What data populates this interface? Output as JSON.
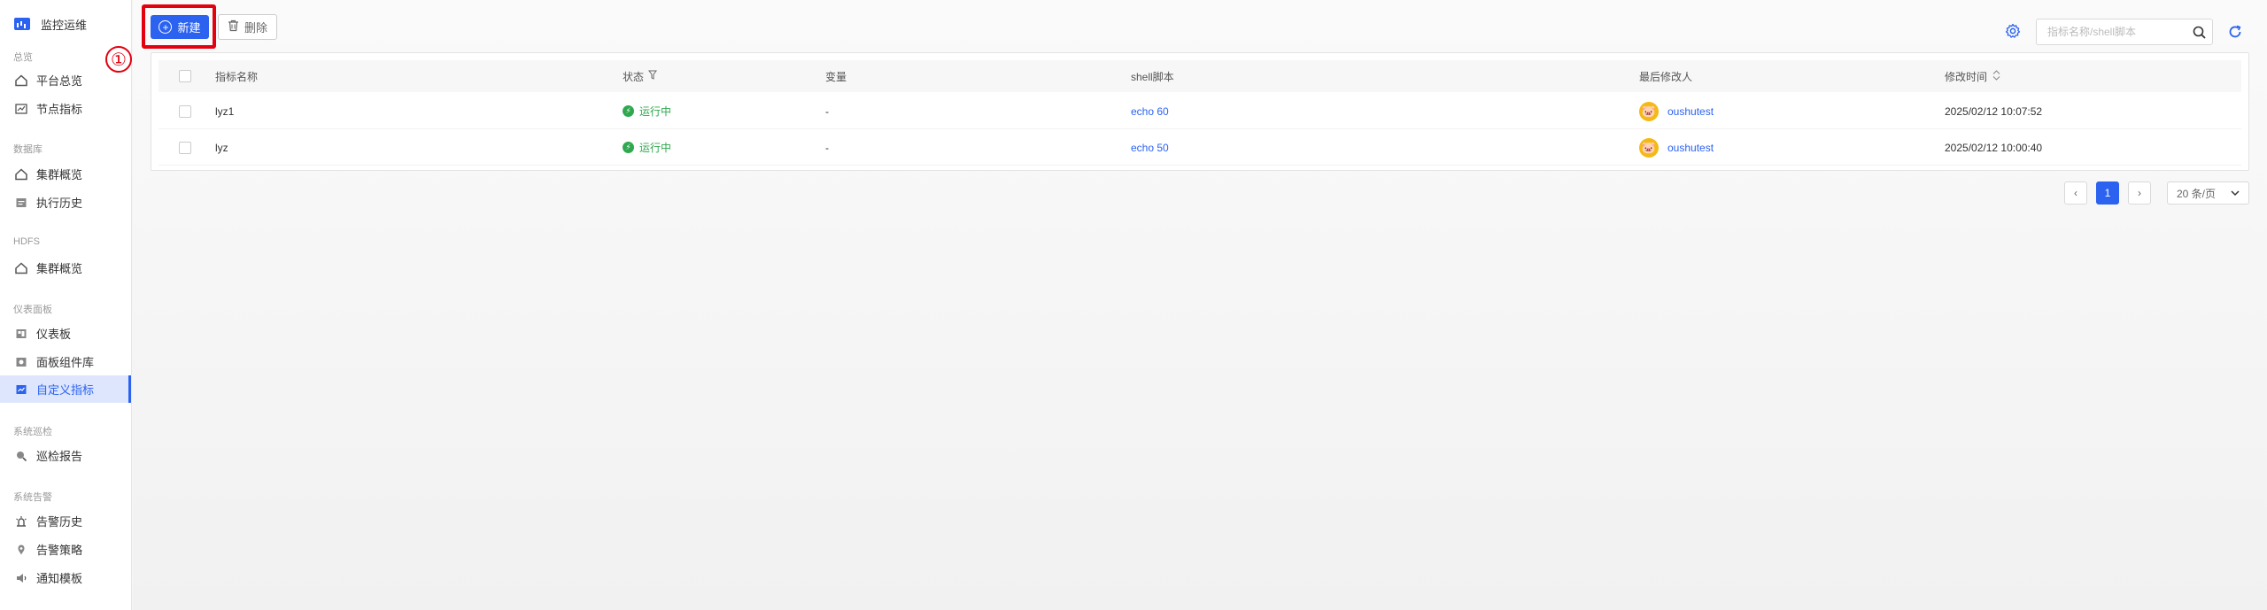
{
  "app": {
    "title": "监控运维",
    "icon": "dashboard-chart-icon"
  },
  "sidebar": {
    "groups": [
      {
        "title": "总览",
        "items": [
          {
            "label": "平台总览",
            "icon": "home-icon"
          },
          {
            "label": "节点指标",
            "icon": "chart-icon"
          }
        ]
      },
      {
        "title": "数据库",
        "items": [
          {
            "label": "集群概览",
            "icon": "home-icon"
          },
          {
            "label": "执行历史",
            "icon": "history-icon"
          }
        ]
      },
      {
        "title": "HDFS",
        "items": [
          {
            "label": "集群概览",
            "icon": "home-icon"
          }
        ]
      },
      {
        "title": "仪表面板",
        "items": [
          {
            "label": "仪表板",
            "icon": "dashboard-icon"
          },
          {
            "label": "面板组件库",
            "icon": "component-library-icon"
          },
          {
            "label": "自定义指标",
            "icon": "custom-metric-icon",
            "active": true
          }
        ]
      },
      {
        "title": "系统巡检",
        "items": [
          {
            "label": "巡检报告",
            "icon": "inspection-icon"
          }
        ]
      },
      {
        "title": "系统告警",
        "items": [
          {
            "label": "告警历史",
            "icon": "alarm-history-icon"
          },
          {
            "label": "告警策略",
            "icon": "alarm-policy-icon"
          },
          {
            "label": "通知模板",
            "icon": "speaker-icon"
          }
        ]
      }
    ]
  },
  "toolbar": {
    "new_label": "新建",
    "delete_label": "删除",
    "step_marker": "①",
    "search_placeholder": "指标名称/shell脚本"
  },
  "table": {
    "columns": [
      "指标名称",
      "状态",
      "变量",
      "shell脚本",
      "最后修改人",
      "修改时间"
    ],
    "rows": [
      {
        "name": "lyz1",
        "status": "运行中",
        "variable": "-",
        "script": "echo 60",
        "modifier": "oushutest",
        "time": "2025/02/12 10:07:52"
      },
      {
        "name": "lyz",
        "status": "运行中",
        "variable": "-",
        "script": "echo 50",
        "modifier": "oushutest",
        "time": "2025/02/12 10:00:40"
      }
    ]
  },
  "pagination": {
    "current_page": "1",
    "page_size": "20 条/页",
    "prev": "‹",
    "next": "›"
  },
  "colors": {
    "accent": "#2b62f0",
    "status_running": "#2fa84f",
    "highlight": "#e3000f"
  }
}
